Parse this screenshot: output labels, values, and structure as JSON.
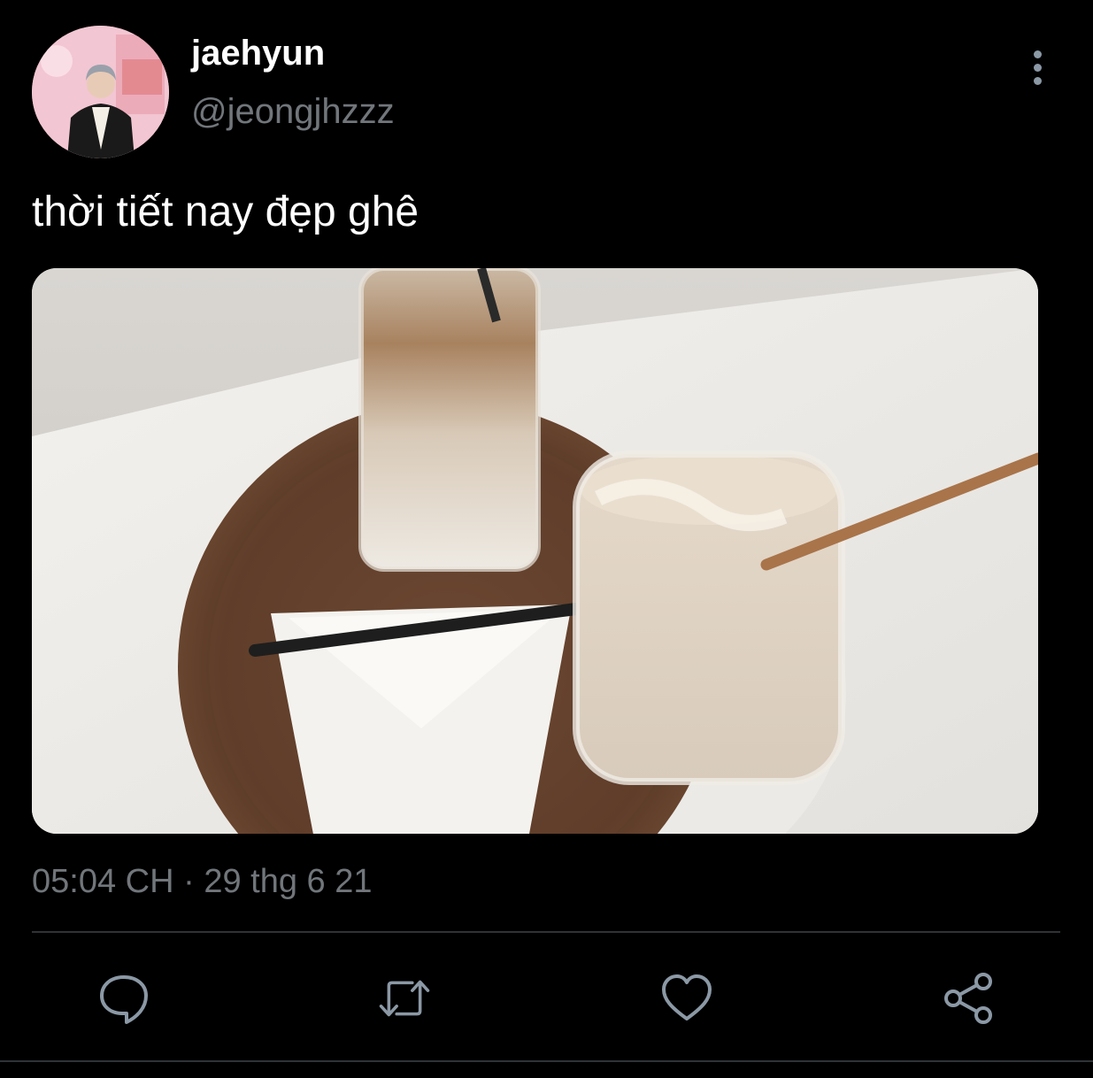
{
  "tweet": {
    "author": {
      "display_name": "jaehyun",
      "handle": "@jeongjhzzz"
    },
    "text": "thời tiết nay đẹp ghê",
    "time": "05:04 CH",
    "separator": "·",
    "date": "29 thg 6 21"
  },
  "actions": [
    {
      "name": "reply",
      "icon": "speech-bubble-icon"
    },
    {
      "name": "retweet",
      "icon": "retweet-icon"
    },
    {
      "name": "like",
      "icon": "heart-icon"
    },
    {
      "name": "share",
      "icon": "share-icon"
    }
  ],
  "colors": {
    "background": "#000000",
    "primary_text": "#ffffff",
    "secondary_text": "#71767b",
    "icon": "#8b98a5",
    "divider": "#2f3336"
  }
}
